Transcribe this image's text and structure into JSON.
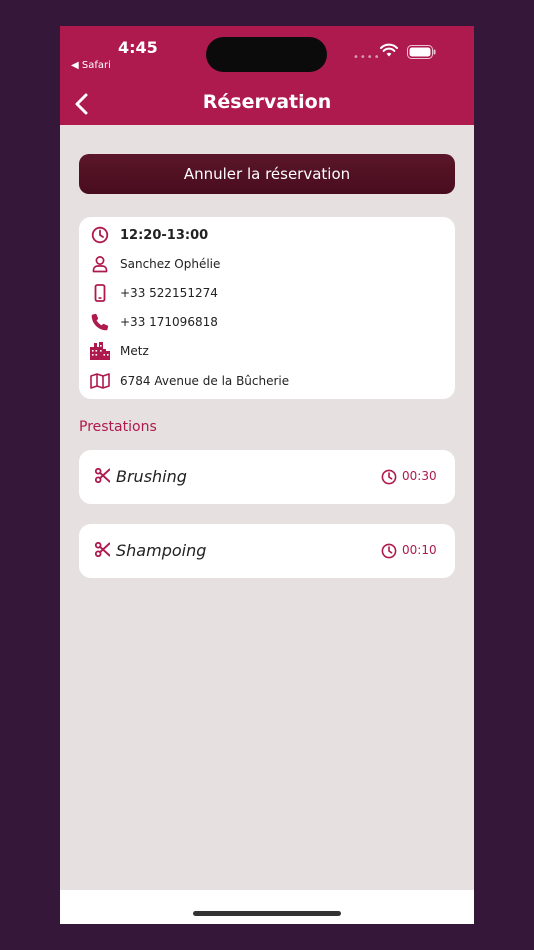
{
  "status": {
    "time": "4:45",
    "back_app": "◀ Safari"
  },
  "header": {
    "title": "Réservation"
  },
  "actions": {
    "cancel_label": "Annuler la réservation"
  },
  "booking": {
    "time_slot": "12:20-13:00",
    "client_name": "Sanchez Ophélie",
    "mobile": "+33 522151274",
    "phone": "+33 171096818",
    "city": "Metz",
    "address": "6784 Avenue de la Bûcherie"
  },
  "prestations": {
    "title": "Prestations",
    "items": [
      {
        "name": "Brushing",
        "duration": "00:30"
      },
      {
        "name": "Shampoing",
        "duration": "00:10"
      }
    ]
  },
  "colors": {
    "accent": "#ae1a4e",
    "button_dark": "#4f1023",
    "background": "#e6e0e1",
    "outer": "#35173a"
  }
}
